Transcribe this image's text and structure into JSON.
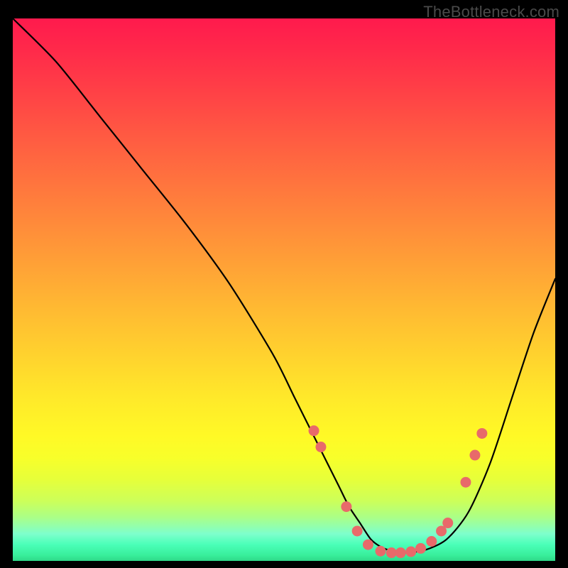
{
  "watermark": "TheBottleneck.com",
  "chart_data": {
    "type": "line",
    "title": "",
    "xlabel": "",
    "ylabel": "",
    "xlim": [
      0,
      100
    ],
    "ylim": [
      0,
      100
    ],
    "series": [
      {
        "name": "bottleneck-curve",
        "x": [
          0,
          8,
          16,
          24,
          32,
          40,
          48,
          52,
          56,
          60,
          62,
          64,
          66,
          68,
          70,
          72,
          76,
          80,
          84,
          88,
          92,
          96,
          100
        ],
        "y": [
          100,
          92,
          82,
          72,
          62,
          51,
          38,
          30,
          22,
          14,
          10,
          7,
          4,
          2.5,
          1.8,
          1.5,
          2,
          4,
          9,
          18,
          30,
          42,
          52
        ]
      }
    ],
    "markers": {
      "name": "highlight-points",
      "color": "#e86a6a",
      "points": [
        {
          "x": 55.5,
          "y": 24
        },
        {
          "x": 56.8,
          "y": 21
        },
        {
          "x": 61.5,
          "y": 10
        },
        {
          "x": 63.5,
          "y": 5.5
        },
        {
          "x": 65.5,
          "y": 3
        },
        {
          "x": 67.8,
          "y": 1.8
        },
        {
          "x": 69.8,
          "y": 1.5
        },
        {
          "x": 71.5,
          "y": 1.5
        },
        {
          "x": 73.4,
          "y": 1.7
        },
        {
          "x": 75.2,
          "y": 2.3
        },
        {
          "x": 77.2,
          "y": 3.6
        },
        {
          "x": 79.0,
          "y": 5.5
        },
        {
          "x": 80.2,
          "y": 7.0
        },
        {
          "x": 83.5,
          "y": 14.5
        },
        {
          "x": 85.2,
          "y": 19.5
        },
        {
          "x": 86.5,
          "y": 23.5
        }
      ]
    }
  }
}
